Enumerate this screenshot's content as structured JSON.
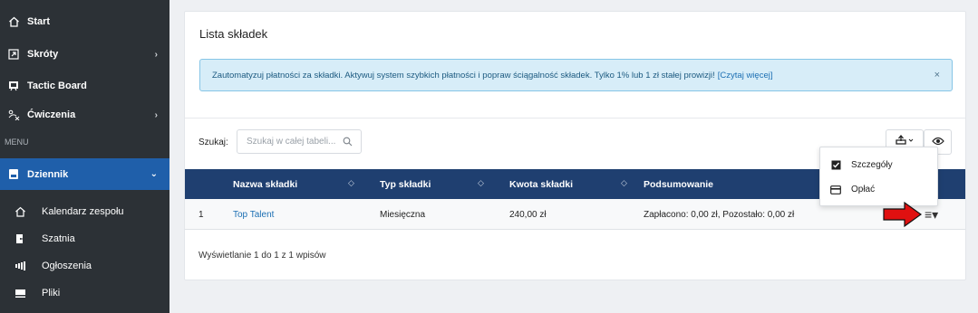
{
  "sidebar": {
    "items": [
      {
        "label": "Start",
        "icon": "home-icon"
      },
      {
        "label": "Skróty",
        "icon": "shortcut-icon",
        "chevron": "›"
      },
      {
        "label": "Tactic Board",
        "icon": "board-icon"
      },
      {
        "label": "Ćwiczenia",
        "icon": "exercise-icon",
        "chevron": "›"
      }
    ],
    "menu_label": "MENU",
    "active_item": {
      "label": "Dziennik",
      "icon": "journal-icon",
      "chevron": "⌄"
    },
    "sub_items": [
      {
        "label": "Kalendarz zespołu",
        "icon": "home-outline-icon"
      },
      {
        "label": "Szatnia",
        "icon": "door-icon"
      },
      {
        "label": "Ogłoszenia",
        "icon": "megaphone-icon"
      },
      {
        "label": "Pliki",
        "icon": "folder-icon"
      }
    ],
    "colors": {
      "background": "#2c3136",
      "active": "#1f5faa"
    }
  },
  "card": {
    "title": "Lista składek",
    "alert": {
      "text": "Zautomatyzuj płatności za składki. Aktywuj system szybkich płatności i popraw ściągalność składek. Tylko 1% lub 1 zł stałej prowizji!",
      "link": "[Czytaj więcej]",
      "close": "×"
    },
    "search": {
      "label": "Szukaj:",
      "placeholder": "Szukaj w całej tabeli..."
    },
    "table": {
      "columns": [
        "Nazwa składki",
        "Typ składki",
        "Kwota składki",
        "Podsumowanie"
      ],
      "sort_glyph": "◇",
      "rows": [
        {
          "no": "1",
          "name": "Top Talent",
          "type": "Miesięczna",
          "amount": "240,00 zł",
          "summary": "Zapłacono: 0,00 zł, Pozostało: 0,00 zł"
        }
      ],
      "header_color": "#1f3f70"
    },
    "footer": "Wyświetlanie 1 do 1 z 1 wpisów"
  },
  "dropdown": {
    "items": [
      {
        "label": "Szczegóły",
        "icon": "check-square-icon"
      },
      {
        "label": "Opłać",
        "icon": "credit-card-icon"
      }
    ]
  },
  "row_menu_glyph": "≡▾",
  "accent_colors": {
    "link": "#1c6fb3",
    "alert_bg": "#d7edf8",
    "arrow": "#e01010"
  }
}
